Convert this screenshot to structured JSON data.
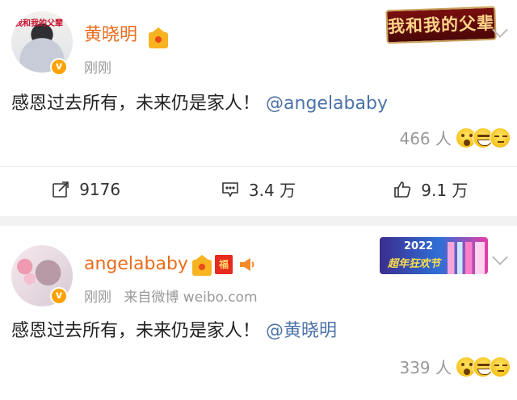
{
  "posts": [
    {
      "author": "黄晓明",
      "avatar_tag": "我和我的父辈",
      "time": "刚刚",
      "content_text": "感恩过去所有，未来仍是家人！",
      "mention": "@angelababy",
      "banner_text": "我和我的父辈",
      "reaction_count": "466 人",
      "reaction_icons": [
        "surprised-emoji-icon",
        "grin-emoji-icon",
        "shy-emoji-icon"
      ],
      "actions": {
        "repost": "9176",
        "comment": "3.4 万",
        "like": "9.1 万"
      }
    },
    {
      "author": "angelababy",
      "time": "刚刚",
      "source": "来自微博 weibo.com",
      "content_text": "感恩过去所有，未来仍是家人！",
      "mention": "@黄晓明",
      "badge_fu": "福",
      "banner_year": "2022",
      "banner_title": "超年狂欢节",
      "reaction_count": "339 人",
      "reaction_icons": [
        "surprised-emoji-icon",
        "grin-emoji-icon",
        "shy-emoji-icon"
      ]
    }
  ],
  "colors": {
    "author_name": "#e86c1c",
    "mention": "#4c73a8",
    "meta_gray": "#999999",
    "separator": "#f2f2f2",
    "verified_badge": "#ffa200"
  }
}
